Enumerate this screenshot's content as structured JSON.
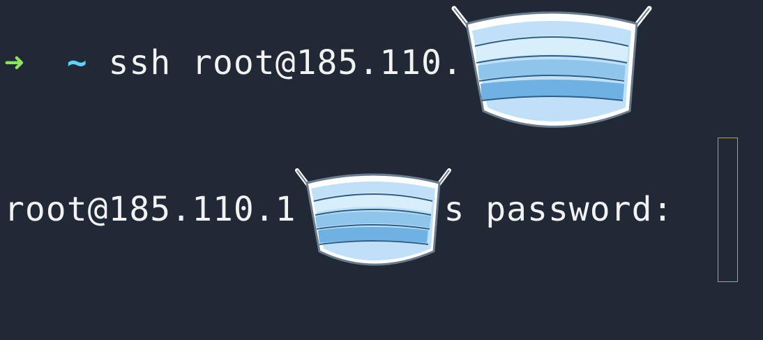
{
  "terminal": {
    "prompt_arrow": "➜",
    "prompt_dir": "~",
    "command": "ssh root@185.110.",
    "password_prompt_user": "root@185.110.1",
    "password_prompt_suffix": "'s password:"
  },
  "colors": {
    "background": "#212936",
    "text": "#f2f2f2",
    "arrow": "#8fe35a",
    "tilde": "#5fd2ff",
    "cursor_border": "#c8a52a"
  },
  "icons": {
    "redaction": "face-mask-icon"
  }
}
